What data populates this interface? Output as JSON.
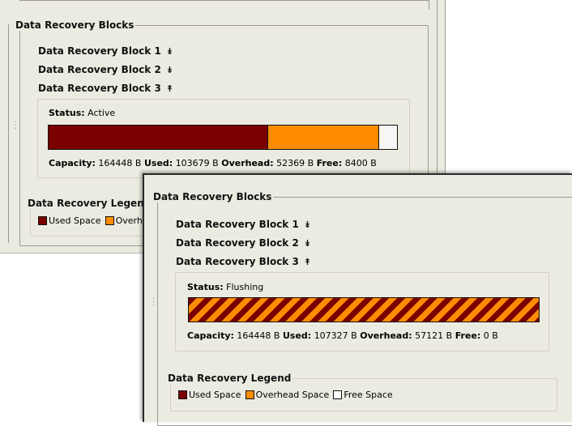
{
  "back_panel": {
    "title": "Data Recovery Blocks",
    "blocks": [
      {
        "label": "Data Recovery Block 1",
        "chevron": "expand-icon"
      },
      {
        "label": "Data Recovery Block 2",
        "chevron": "expand-icon"
      },
      {
        "label": "Data Recovery Block 3",
        "chevron": "collapse-icon"
      }
    ],
    "detail": {
      "status_label": "Status:",
      "status_value": "Active",
      "bar": {
        "used_fraction": 0.6305,
        "overhead_fraction": 0.3185,
        "free_fraction": 0.0511
      },
      "capacity_label": "Capacity:",
      "capacity_value": "164448 B",
      "used_label": "Used:",
      "used_value": "103679 B",
      "overhead_label": "Overhead:",
      "overhead_value": "52369 B",
      "free_label": "Free:",
      "free_value": "8400 B"
    },
    "legend": {
      "title": "Data Recovery Legend",
      "used": "Used Space",
      "overhead_partial": "Overh"
    }
  },
  "front_panel": {
    "title": "Data Recovery Blocks",
    "blocks": [
      {
        "label": "Data Recovery Block 1",
        "chevron": "expand-icon"
      },
      {
        "label": "Data Recovery Block 2",
        "chevron": "expand-icon"
      },
      {
        "label": "Data Recovery Block 3",
        "chevron": "collapse-icon"
      }
    ],
    "detail": {
      "status_label": "Status:",
      "status_value": "Flushing",
      "capacity_label": "Capacity:",
      "capacity_value": "164448 B",
      "used_label": "Used:",
      "used_value": "107327 B",
      "overhead_label": "Overhead:",
      "overhead_value": "57121 B",
      "free_label": "Free:",
      "free_value": "0 B"
    },
    "legend": {
      "title": "Data Recovery Legend",
      "used": "Used Space",
      "overhead": "Overhead Space",
      "free": "Free Space"
    }
  },
  "colors": {
    "used": "#7a0000",
    "overhead": "#ff8c00",
    "free": "#f6f6f6",
    "panel_bg": "#ecebe1"
  }
}
